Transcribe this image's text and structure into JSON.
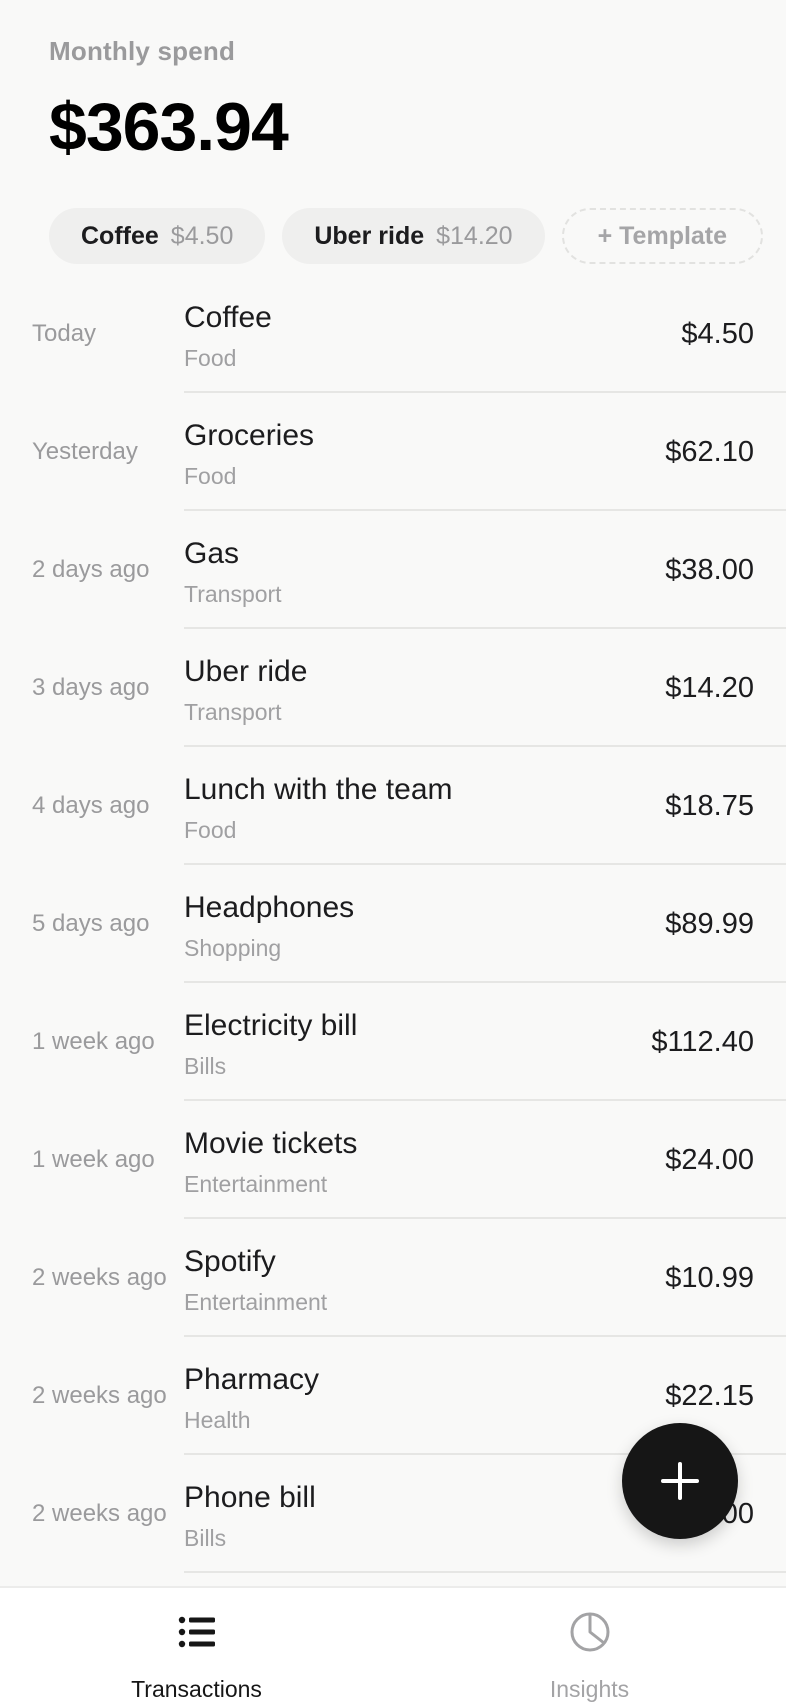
{
  "header": {
    "label": "Monthly spend",
    "total": "$363.94"
  },
  "templates": [
    {
      "name": "Coffee",
      "amount": "$4.50"
    },
    {
      "name": "Uber ride",
      "amount": "$14.20"
    }
  ],
  "add_template_label": "+ Template",
  "transactions": [
    {
      "date": "Today",
      "title": "Coffee",
      "category": "Food",
      "amount": "$4.50"
    },
    {
      "date": "Yesterday",
      "title": "Groceries",
      "category": "Food",
      "amount": "$62.10"
    },
    {
      "date": "2 days ago",
      "title": "Gas",
      "category": "Transport",
      "amount": "$38.00"
    },
    {
      "date": "3 days ago",
      "title": "Uber ride",
      "category": "Transport",
      "amount": "$14.20"
    },
    {
      "date": "4 days ago",
      "title": "Lunch with the team",
      "category": "Food",
      "amount": "$18.75"
    },
    {
      "date": "5 days ago",
      "title": "Headphones",
      "category": "Shopping",
      "amount": "$89.99"
    },
    {
      "date": "1 week ago",
      "title": "Electricity bill",
      "category": "Bills",
      "amount": "$112.40"
    },
    {
      "date": "1 week ago",
      "title": "Movie tickets",
      "category": "Entertainment",
      "amount": "$24.00"
    },
    {
      "date": "2 weeks ago",
      "title": "Spotify",
      "category": "Entertainment",
      "amount": "$10.99"
    },
    {
      "date": "2 weeks ago",
      "title": "Pharmacy",
      "category": "Health",
      "amount": "$22.15"
    },
    {
      "date": "2 weeks ago",
      "title": "Phone bill",
      "category": "Bills",
      "amount": "$45.00"
    }
  ],
  "fab": {
    "icon": "plus-icon"
  },
  "tabs": [
    {
      "label": "Transactions",
      "icon": "list-icon",
      "active": true
    },
    {
      "label": "Insights",
      "icon": "pie-chart-icon",
      "active": false
    }
  ],
  "colors": {
    "background": "#f9f9f8",
    "fab": "#161616",
    "muted_text": "#9a9a9c"
  }
}
